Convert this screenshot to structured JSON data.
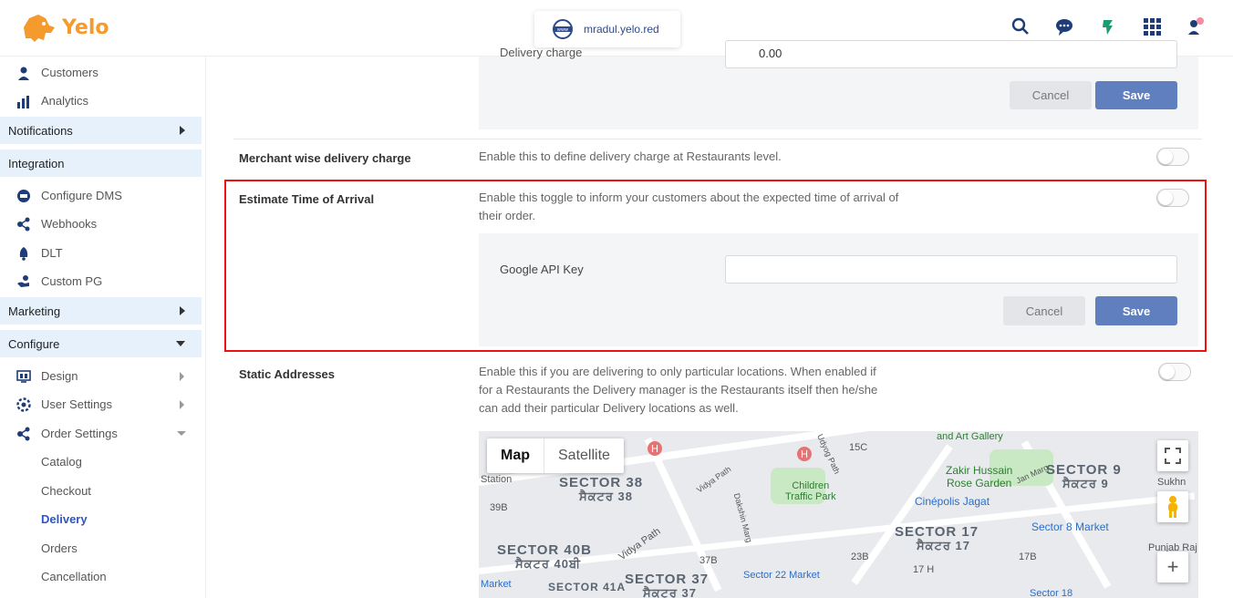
{
  "brand": {
    "name": "Yelo",
    "color": "#f59a2c"
  },
  "header": {
    "url": "mradul.yelo.red",
    "icons": [
      "search-icon",
      "chat-support-icon",
      "feather-icon",
      "apps-grid-icon",
      "user-profile-icon"
    ]
  },
  "sidebar": {
    "items_top": [
      {
        "label": "Customers",
        "icon": "customers-icon"
      },
      {
        "label": "Analytics",
        "icon": "analytics-icon"
      }
    ],
    "sections": {
      "notifications": "Notifications",
      "integration": "Integration",
      "marketing": "Marketing",
      "configure": "Configure"
    },
    "integration_items": [
      {
        "label": "Configure DMS",
        "icon": "dms-icon"
      },
      {
        "label": "Webhooks",
        "icon": "webhooks-icon"
      },
      {
        "label": "DLT",
        "icon": "dlt-icon"
      },
      {
        "label": "Custom PG",
        "icon": "custom-pg-icon"
      }
    ],
    "configure_items": [
      {
        "label": "Design",
        "icon": "design-icon"
      },
      {
        "label": "User Settings",
        "icon": "user-settings-icon"
      },
      {
        "label": "Order Settings",
        "icon": "order-settings-icon"
      }
    ],
    "order_sub_items": [
      "Catalog",
      "Checkout",
      "Delivery",
      "Orders",
      "Cancellation"
    ],
    "active_item": "Delivery"
  },
  "main": {
    "top_panel": {
      "field_label": "Delivery charge",
      "field_value": "0.00",
      "cancel": "Cancel",
      "save": "Save"
    },
    "merchant_row": {
      "title": "Merchant wise delivery charge",
      "desc": "Enable this to define delivery charge at Restaurants level.",
      "enabled": false
    },
    "eta_row": {
      "title": "Estimate Time of Arrival",
      "desc_line1": "Enable this toggle to inform your customers about the expected time of arrival of",
      "desc_line2": "their order.",
      "enabled": false,
      "field_label": "Google API Key",
      "field_value": "",
      "cancel": "Cancel",
      "save": "Save"
    },
    "static_row": {
      "title": "Static Addresses",
      "desc_line1": "Enable this if you are delivering to only particular locations. When enabled if",
      "desc_line2": "for a Restaurants the Delivery manager is the Restaurants itself then he/she",
      "desc_line3": "can add their particular Delivery locations as well.",
      "enabled": false
    },
    "map": {
      "tab_map": "Map",
      "tab_satellite": "Satellite",
      "labels": {
        "sector38": "SECTOR 38",
        "sector38p": "ਸੈਕਟਰ 38",
        "sector40b": "SECTOR 40B",
        "sector40bp": "ਸੈਕਟਰ 40ਬੀ",
        "sector37": "SECTOR 37",
        "sector37p": "ਸੈਕਟਰ 37",
        "sector41a": "SECTOR 41A",
        "sector17": "SECTOR 17",
        "sector17p": "ਸੈਕਟਰ 17",
        "sector9": "SECTOR 9",
        "sector9p": "ਸੈਕਟਰ 9",
        "childrenpark": "Children\nTraffic Park",
        "zakir": "Zakir Hussain\nRose Garden",
        "cinepolis": "Cinépolis Jagat",
        "artgallery": "and Art Gallery",
        "sector8market": "Sector 8 Market",
        "sector22market": "Sector 22 Market",
        "sector18": "Sector 18",
        "station": "Station",
        "market": "Market",
        "c39b": "39B",
        "c37b": "37B",
        "c23b": "23B",
        "c17b": "17B",
        "c17h": "17 H",
        "c15c": "15C",
        "vidya": "Vidya Path",
        "dakshin": "Dakshin Marg",
        "udyog": "Udyog Path",
        "jan": "Jan Marg",
        "sukhn": "Sukhn",
        "punjab": "Punjab Raj B"
      }
    }
  }
}
